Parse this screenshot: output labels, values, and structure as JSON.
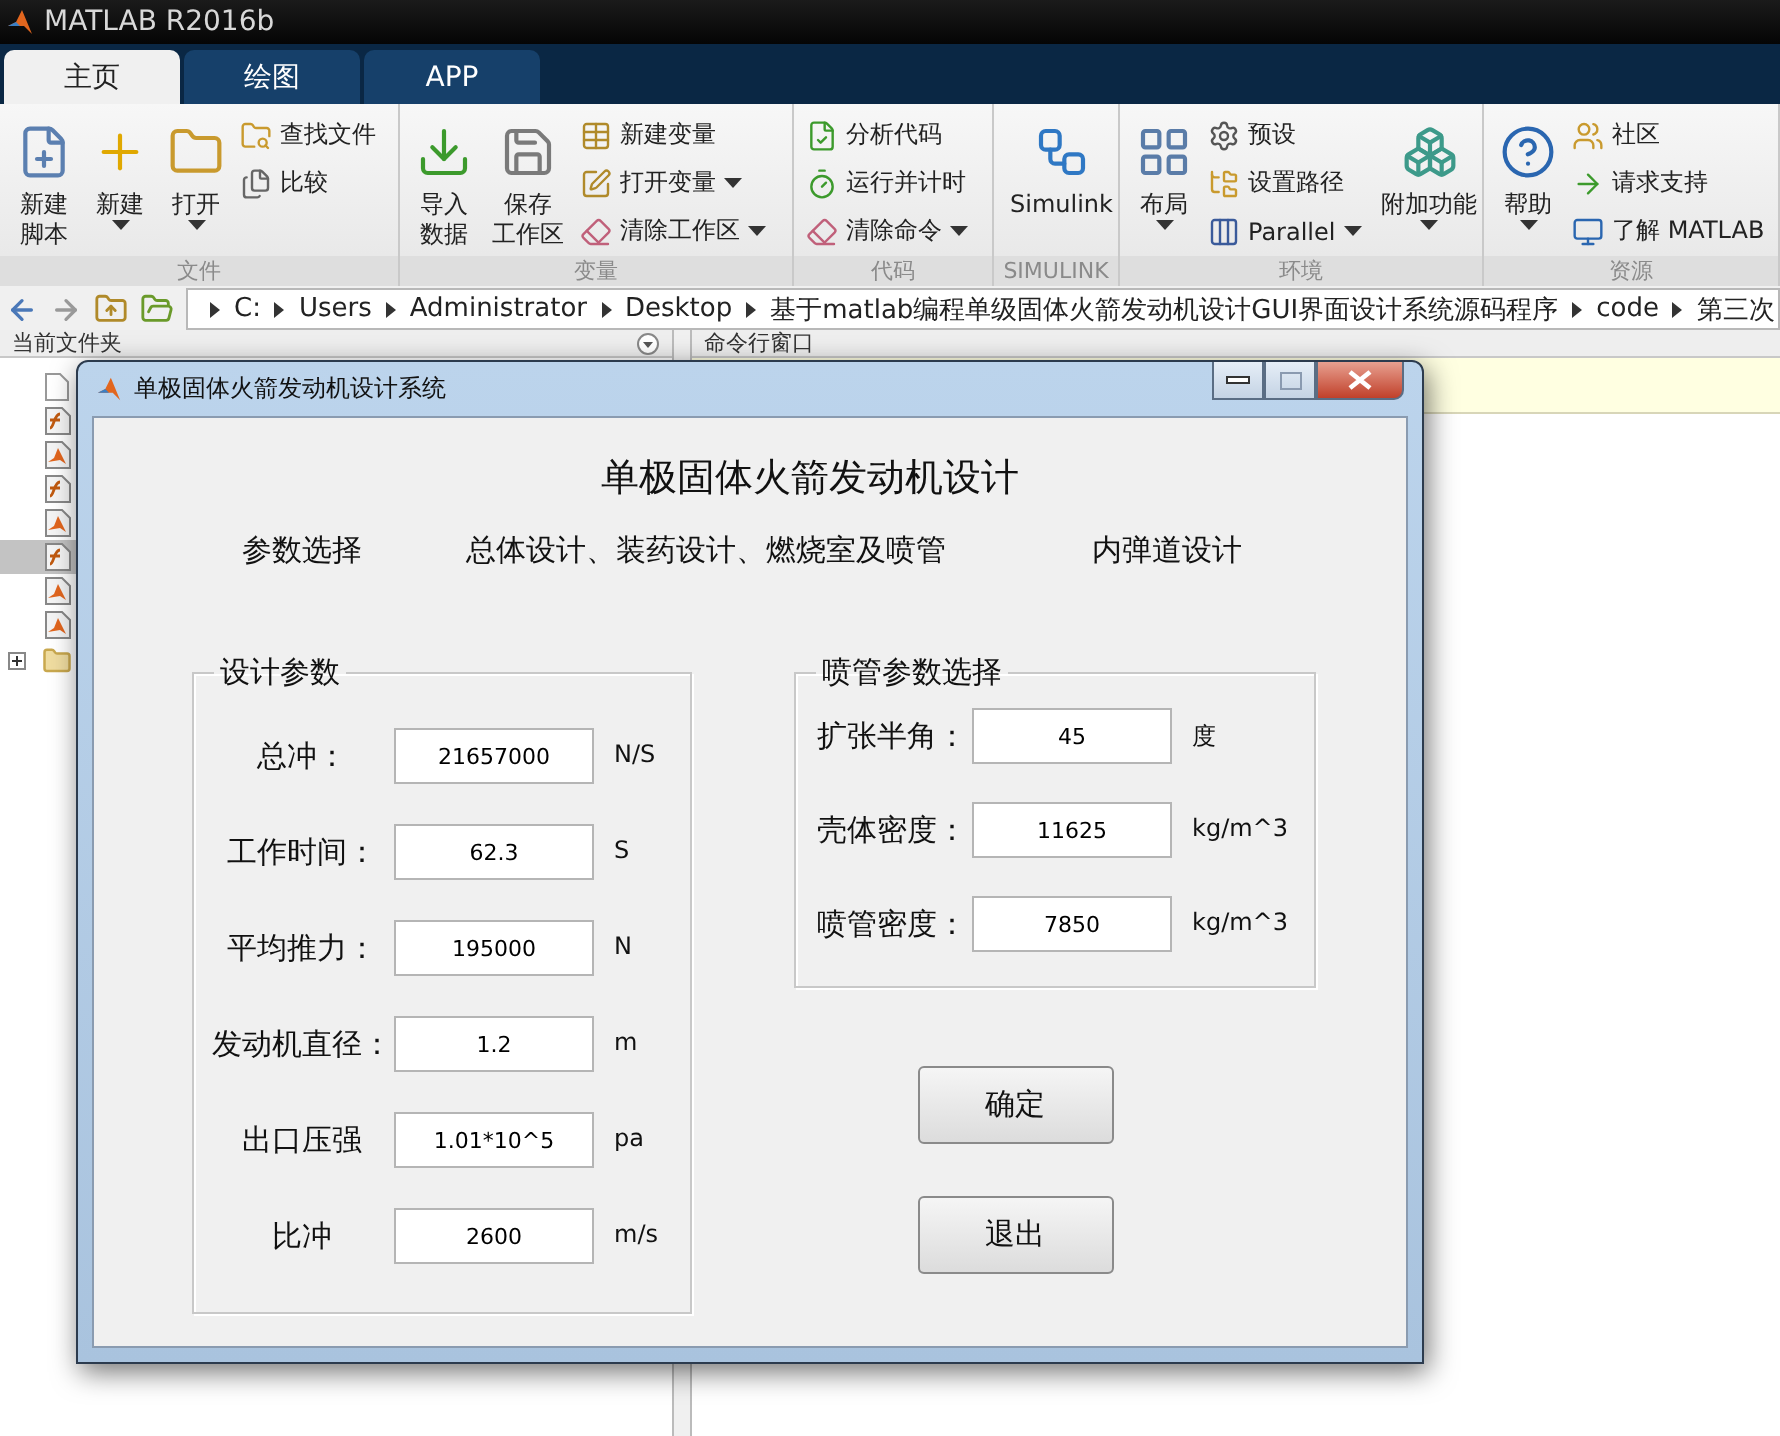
{
  "window": {
    "title": "MATLAB R2016b"
  },
  "tabs": [
    {
      "label": "主页",
      "selected": true
    },
    {
      "label": "绘图",
      "selected": false
    },
    {
      "label": "APP",
      "selected": false
    }
  ],
  "toolstrip": {
    "groups": [
      {
        "label": "文件",
        "items": [
          {
            "kind": "large",
            "lines": [
              "新建",
              "脚本"
            ],
            "dropdown": false
          },
          {
            "kind": "large",
            "lines": [
              "新建"
            ],
            "dropdown": true
          },
          {
            "kind": "large",
            "lines": [
              "打开"
            ],
            "dropdown": true
          },
          {
            "kind": "column",
            "buttons": [
              {
                "label": "查找文件",
                "dropdown": false
              },
              {
                "label": "比较",
                "dropdown": false
              }
            ]
          }
        ]
      },
      {
        "label": "变量",
        "items": [
          {
            "kind": "large",
            "lines": [
              "导入",
              "数据"
            ],
            "dropdown": false
          },
          {
            "kind": "large",
            "lines": [
              "保存",
              "工作区"
            ],
            "dropdown": false
          },
          {
            "kind": "column",
            "buttons": [
              {
                "label": "新建变量",
                "dropdown": false
              },
              {
                "label": "打开变量",
                "dropdown": true
              },
              {
                "label": "清除工作区",
                "dropdown": true
              }
            ]
          }
        ]
      },
      {
        "label": "代码",
        "items": [
          {
            "kind": "column",
            "buttons": [
              {
                "label": "分析代码",
                "dropdown": false
              },
              {
                "label": "运行并计时",
                "dropdown": false
              },
              {
                "label": "清除命令",
                "dropdown": true
              }
            ]
          }
        ]
      },
      {
        "label": "SIMULINK",
        "items": [
          {
            "kind": "large",
            "lines": [
              "Simulink"
            ],
            "dropdown": false
          }
        ]
      },
      {
        "label": "环境",
        "items": [
          {
            "kind": "large",
            "lines": [
              "布局"
            ],
            "dropdown": true
          },
          {
            "kind": "column",
            "buttons": [
              {
                "label": "预设",
                "dropdown": false
              },
              {
                "label": "设置路径",
                "dropdown": false
              },
              {
                "label": "Parallel",
                "dropdown": true
              }
            ]
          },
          {
            "kind": "large",
            "lines": [
              "附加功能"
            ],
            "dropdown": true
          }
        ]
      },
      {
        "label": "资源",
        "items": [
          {
            "kind": "large",
            "lines": [
              "帮助"
            ],
            "dropdown": true
          },
          {
            "kind": "column",
            "buttons": [
              {
                "label": "社区",
                "dropdown": false
              },
              {
                "label": "请求支持",
                "dropdown": false
              },
              {
                "label": "了解 MATLAB",
                "dropdown": false
              }
            ]
          }
        ]
      }
    ]
  },
  "address_bar": {
    "path": [
      "C:",
      "Users",
      "Administrator",
      "Desktop",
      "基于matlab编程单级固体火箭发动机设计GUI界面设计系统源码程序",
      "code",
      "第三次"
    ]
  },
  "folder_panel": {
    "title": "当前文件夹",
    "files": [
      {
        "kind": "document",
        "selected": false
      },
      {
        "kind": "function",
        "selected": false
      },
      {
        "kind": "script",
        "selected": false
      },
      {
        "kind": "function",
        "selected": false
      },
      {
        "kind": "script",
        "selected": false
      },
      {
        "kind": "function",
        "selected": true
      },
      {
        "kind": "script",
        "selected": false
      },
      {
        "kind": "script",
        "selected": false
      }
    ],
    "folders": [
      {
        "expanded": false
      }
    ]
  },
  "command_window": {
    "title": "命令行窗口"
  },
  "dialog": {
    "title": "单极固体火箭发动机设计系统",
    "heading": "单极固体火箭发动机设计",
    "sections": [
      "参数选择",
      "总体设计、装药设计、燃烧室及喷管",
      "内弹道设计"
    ],
    "panels": [
      {
        "title": "设计参数",
        "fields": [
          {
            "label": "总冲：",
            "value": "21657000",
            "unit": "N/S"
          },
          {
            "label": "工作时间：",
            "value": "62.3",
            "unit": "S"
          },
          {
            "label": "平均推力：",
            "value": "195000",
            "unit": "N"
          },
          {
            "label": "发动机直径：",
            "value": "1.2",
            "unit": "m"
          },
          {
            "label": "出口压强",
            "value": "1.01*10^5",
            "unit": "pa"
          },
          {
            "label": "比冲",
            "value": "2600",
            "unit": "m/s"
          }
        ]
      },
      {
        "title": "喷管参数选择",
        "fields": [
          {
            "label": "扩张半角：",
            "value": "45",
            "unit": "度"
          },
          {
            "label": "壳体密度：",
            "value": "11625",
            "unit": "kg/m^3"
          },
          {
            "label": "喷管密度：",
            "value": "7850",
            "unit": "kg/m^3"
          }
        ]
      }
    ],
    "buttons": [
      "确定",
      "退出"
    ]
  }
}
